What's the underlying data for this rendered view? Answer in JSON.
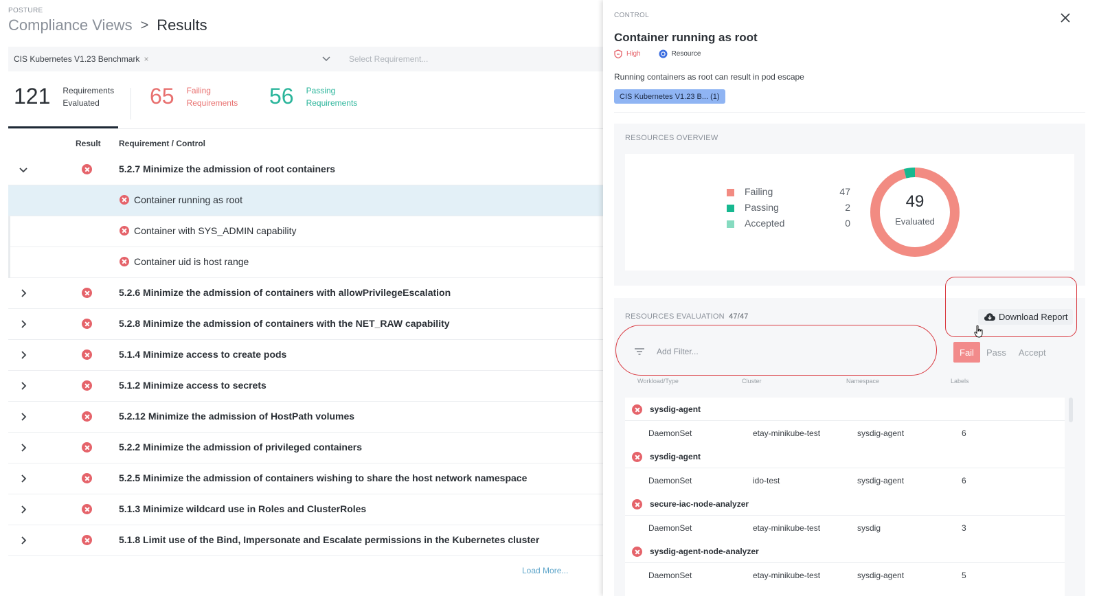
{
  "header": {
    "eyebrow": "POSTURE",
    "breadcrumb_parent": "Compliance Views",
    "breadcrumb_separator": ">",
    "breadcrumb_current": "Results"
  },
  "filters": {
    "benchmark_selected": "CIS Kubernetes V1.23 Benchmark",
    "benchmark_remove": "×",
    "requirement_placeholder": "Select Requirement..."
  },
  "stats": {
    "evaluated_count": "121",
    "evaluated_label_1": "Requirements",
    "evaluated_label_2": "Evaluated",
    "failing_count": "65",
    "failing_label_1": "Failing",
    "failing_label_2": "Requirements",
    "passing_count": "56",
    "passing_label_1": "Passing",
    "passing_label_2": "Requirements"
  },
  "table": {
    "col_result": "Result",
    "col_requirement": "Requirement / Control",
    "rows": [
      {
        "label": "5.2.7 Minimize the admission of root containers",
        "expanded": true
      },
      {
        "label": "Container running as root",
        "child": true,
        "selected": true
      },
      {
        "label": "Container with SYS_ADMIN capability",
        "child": true
      },
      {
        "label": "Container uid is host range",
        "child": true
      },
      {
        "label": "5.2.6 Minimize the admission of containers with allowPrivilegeEscalation"
      },
      {
        "label": "5.2.8 Minimize the admission of containers with the NET_RAW capability"
      },
      {
        "label": "5.1.4 Minimize access to create pods"
      },
      {
        "label": "5.1.2 Minimize access to secrets"
      },
      {
        "label": "5.2.12 Minimize the admission of HostPath volumes"
      },
      {
        "label": "5.2.2 Minimize the admission of privileged containers"
      },
      {
        "label": "5.2.5 Minimize the admission of containers wishing to share the host network namespace"
      },
      {
        "label": "5.1.3 Minimize wildcard use in Roles and ClusterRoles"
      },
      {
        "label": "5.1.8 Limit use of the Bind, Impersonate and Escalate permissions in the Kubernetes cluster"
      }
    ],
    "load_more": "Load More..."
  },
  "control": {
    "eyebrow": "CONTROL",
    "title": "Container running as root",
    "severity": "High",
    "type": "Resource",
    "description": "Running containers as root can result in pod escape",
    "chip": "CIS Kubernetes V1.23 B... (1)"
  },
  "overview": {
    "title": "RESOURCES OVERVIEW",
    "legend": [
      {
        "name": "Failing",
        "value": "47",
        "color": "#f28b82"
      },
      {
        "name": "Passing",
        "value": "2",
        "color": "#17b890"
      },
      {
        "name": "Accepted",
        "value": "0",
        "color": "#86dbc0"
      }
    ],
    "total": "49",
    "total_label": "Evaluated"
  },
  "evaluation": {
    "title": "RESOURCES EVALUATION",
    "count": "47/47",
    "download_label": "Download Report",
    "filter_placeholder": "Add Filter...",
    "segments": [
      "Fail",
      "Pass",
      "Accept"
    ],
    "active_segment": "Fail",
    "columns": [
      "Workload/Type",
      "Cluster",
      "Namespace",
      "Labels"
    ],
    "items": [
      {
        "name": "sysdig-agent",
        "type": "DaemonSet",
        "cluster": "etay-minikube-test",
        "namespace": "sysdig-agent",
        "labels": "6"
      },
      {
        "name": "sysdig-agent",
        "type": "DaemonSet",
        "cluster": "ido-test",
        "namespace": "sysdig-agent",
        "labels": "6"
      },
      {
        "name": "secure-iac-node-analyzer",
        "type": "DaemonSet",
        "cluster": "etay-minikube-test",
        "namespace": "sysdig",
        "labels": "3"
      },
      {
        "name": "sysdig-agent-node-analyzer",
        "type": "DaemonSet",
        "cluster": "etay-minikube-test",
        "namespace": "sysdig-agent",
        "labels": "5"
      }
    ]
  },
  "colors": {
    "fail": "#e5636a",
    "fail_text": "#e8706f",
    "pass": "#2bb59b",
    "selected_row": "#e3f0f7",
    "chip": "#8fb4f3",
    "annotation": "#d9383f"
  }
}
